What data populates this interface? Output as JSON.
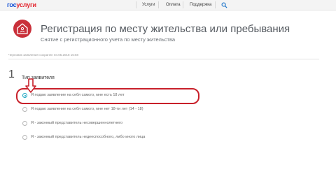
{
  "header": {
    "logo_part1": "гос",
    "logo_part2": "услуги",
    "nav": [
      "Услуги",
      "Оплата",
      "Поддержка"
    ]
  },
  "page": {
    "title": "Регистрация по месту жительства или пребывания",
    "subtitle": "Снятие с регистрационного учета по месту жительства",
    "draft_note": "Черновик заявления сохранен 04.05.2018 15:58"
  },
  "step": {
    "number": "1",
    "label": "Тип заявителя",
    "options": [
      {
        "label": "Я подаю заявление на себя самого, мне есть 18 лет",
        "checked": true
      },
      {
        "label": "Я подаю заявление на себя самого, мне нет 18-ти лет (14 - 18)",
        "checked": false
      },
      {
        "label": "Я - законный представитель несовершеннолетнего",
        "checked": false
      },
      {
        "label": "Я - законный представитель недееспособного, либо иного лица",
        "checked": false
      }
    ]
  },
  "colors": {
    "brand_blue": "#0d4cd3",
    "brand_red": "#e3232c",
    "icon_red": "#c9303a",
    "annotation_red": "#c8202a",
    "radio_accent": "#1aa5c1"
  }
}
